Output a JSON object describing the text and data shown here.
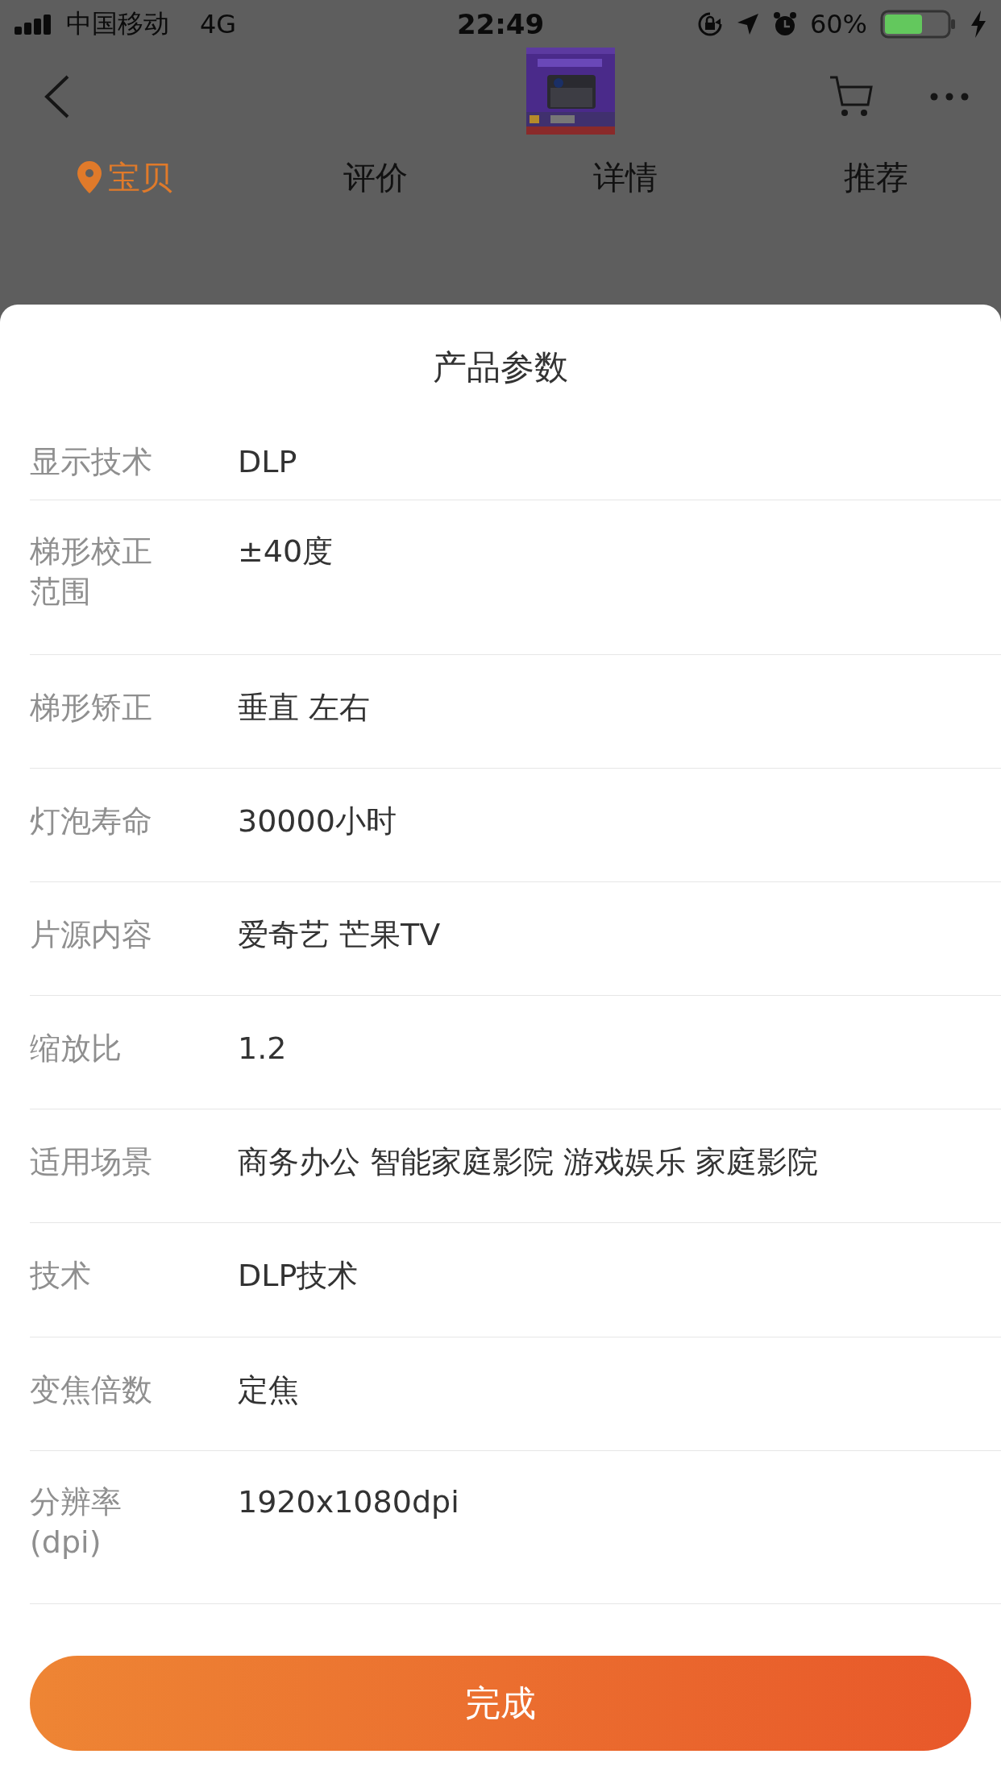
{
  "status_bar": {
    "carrier": "中国移动",
    "network": "4G",
    "time": "22:49",
    "battery": "60%"
  },
  "tabs": [
    {
      "label": "宝贝",
      "selected": true
    },
    {
      "label": "评价",
      "selected": false
    },
    {
      "label": "详情",
      "selected": false
    },
    {
      "label": "推荐",
      "selected": false
    }
  ],
  "sheet": {
    "title": "产品参数",
    "params": [
      {
        "name": "显示技术",
        "value": "DLP"
      },
      {
        "name": "梯形校正范围",
        "value": "±40度"
      },
      {
        "name": "梯形矫正",
        "value": "垂直 左右"
      },
      {
        "name": "灯泡寿命",
        "value": "30000小时"
      },
      {
        "name": "片源内容",
        "value": "爱奇艺 芒果TV"
      },
      {
        "name": "缩放比",
        "value": "1.2"
      },
      {
        "name": "适用场景",
        "value": "商务办公 智能家庭影院 游戏娱乐 家庭影院"
      },
      {
        "name": "技术",
        "value": "DLP技术"
      },
      {
        "name": "变焦倍数",
        "value": "定焦"
      },
      {
        "name": "分辨率(dpi)",
        "value": "1920x1080dpi"
      }
    ],
    "done_button": "完成"
  }
}
